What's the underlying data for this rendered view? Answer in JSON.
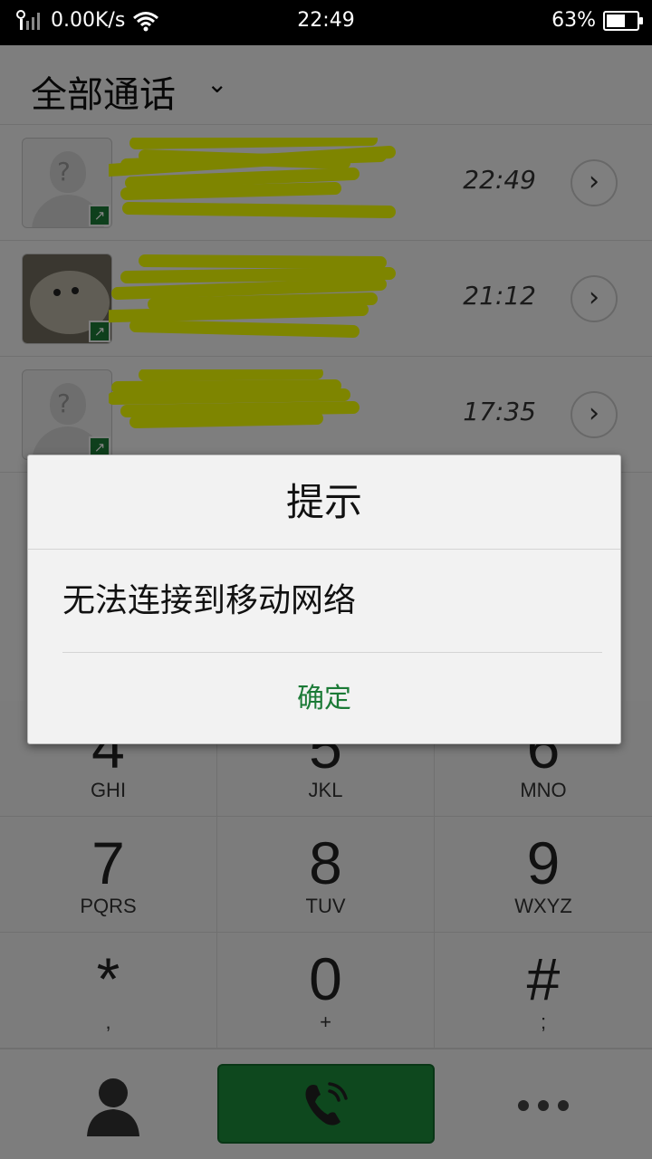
{
  "status_bar": {
    "speed": "0.00K/s",
    "time": "22:49",
    "battery": "63%",
    "battery_level": 0.63
  },
  "header": {
    "title": "全部通话",
    "dropdown_icon": "chevron-down-icon"
  },
  "calls": [
    {
      "time": "22:49",
      "avatar": "placeholder"
    },
    {
      "time": "21:12",
      "avatar": "photo"
    },
    {
      "time": "17:35",
      "avatar": "placeholder"
    }
  ],
  "dialpad": {
    "keys": [
      {
        "digit": "4",
        "letters": "GHI"
      },
      {
        "digit": "5",
        "letters": "JKL"
      },
      {
        "digit": "6",
        "letters": "MNO"
      },
      {
        "digit": "7",
        "letters": "PQRS"
      },
      {
        "digit": "8",
        "letters": "TUV"
      },
      {
        "digit": "9",
        "letters": "WXYZ"
      },
      {
        "digit": "*",
        "letters": ","
      },
      {
        "digit": "0",
        "letters": "+"
      },
      {
        "digit": "#",
        "letters": ";"
      }
    ]
  },
  "dialog": {
    "title": "提示",
    "message": "无法连接到移动网络",
    "ok_label": "确定"
  },
  "colors": {
    "accent_green": "#1c8a3a",
    "highlighter": "#f2ff00"
  }
}
